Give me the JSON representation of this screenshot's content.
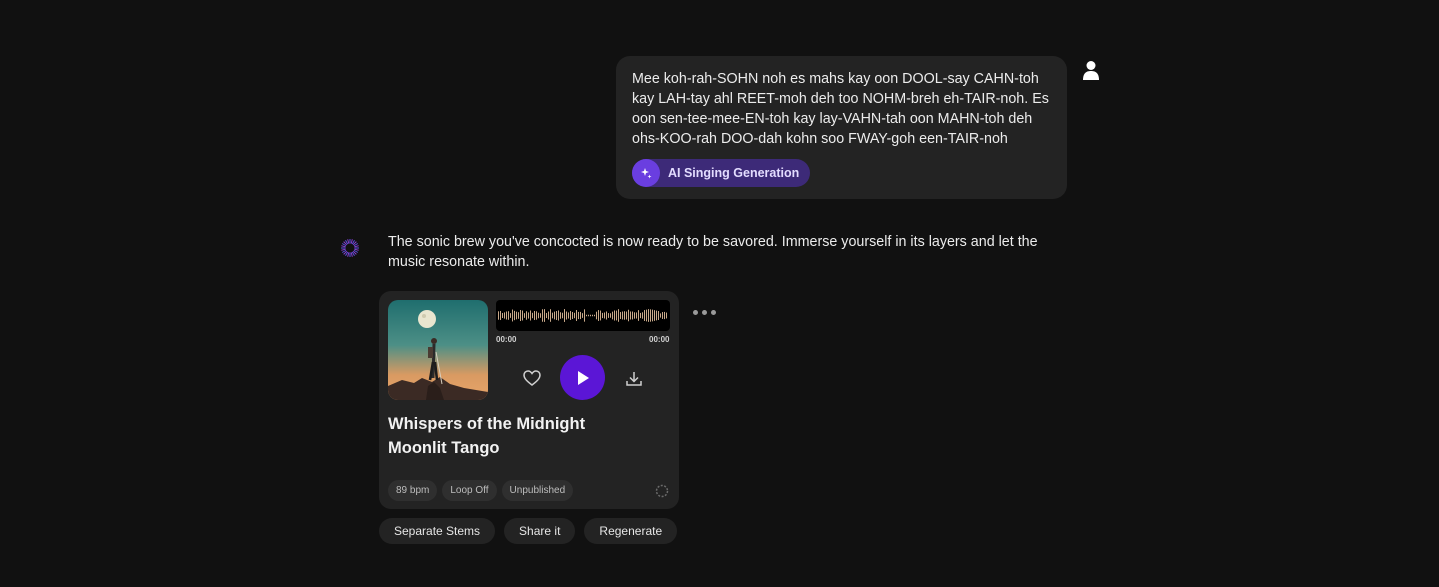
{
  "user_message": {
    "text": "Mee koh-rah-SOHN noh es mahs kay oon DOOL-say CAHN-toh kay LAH-tay ahl REET-moh deh too NOHM-breh eh-TAIR-noh. Es oon sen-tee-mee-EN-toh kay lay-VAHN-tah oon MAHN-toh deh ohs-KOO-rah DOO-dah kohn soo FWAY-goh een-TAIR-noh",
    "tag_label": "AI Singing Generation",
    "tag_icon": "sparkle-icon",
    "avatar_icon": "user-icon"
  },
  "assistant": {
    "avatar_icon": "dotted-ring-icon",
    "text": "The sonic brew you've concocted is now ready to be savored. Immerse yourself in its layers and let the music resonate within."
  },
  "song_card": {
    "title": "Whispers of the Midnight Moonlit Tango",
    "time_current": "00:00",
    "time_total": "00:00",
    "bpm": "89 bpm",
    "loop": "Loop Off",
    "status": "Unpublished",
    "progress": 0
  },
  "actions": {
    "separate_stems": "Separate Stems",
    "share": "Share it",
    "regenerate": "Regenerate"
  },
  "colors": {
    "background": "#111111",
    "bubble": "#232323",
    "accent": "#5b16d6",
    "tag_bg": "#3d2a78",
    "tag_icon_bg": "#6a3ee0"
  }
}
